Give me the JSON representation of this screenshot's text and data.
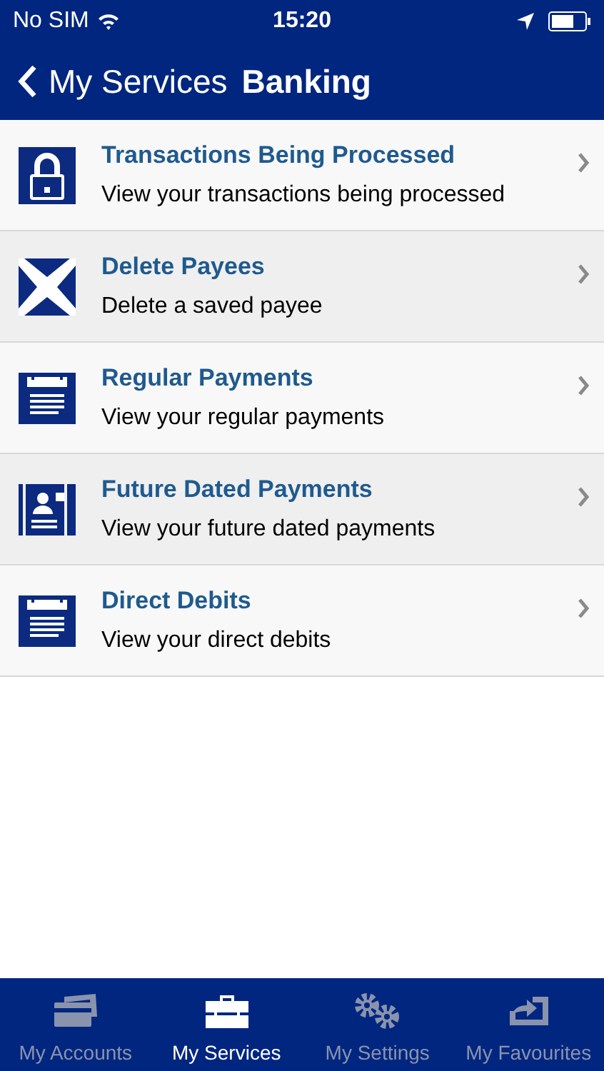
{
  "status_bar": {
    "carrier": "No SIM",
    "time": "15:20"
  },
  "nav_bar": {
    "back_label": "My Services",
    "title": "Banking"
  },
  "items": [
    {
      "kind": "lock",
      "title": "Transactions Being Processed",
      "subtitle": "View your transactions being processed"
    },
    {
      "kind": "cross",
      "title": "Delete Payees",
      "subtitle": "Delete a saved payee"
    },
    {
      "kind": "calendar",
      "title": "Regular Payments",
      "subtitle": "View your regular payments"
    },
    {
      "kind": "person",
      "title": "Future Dated Payments",
      "subtitle": "View your future dated payments"
    },
    {
      "kind": "calendar",
      "title": "Direct Debits",
      "subtitle": "View your direct debits"
    }
  ],
  "tab_bar": [
    {
      "kind": "cards",
      "label": "My Accounts",
      "selected": false
    },
    {
      "kind": "briefcase",
      "label": "My Services",
      "selected": true
    },
    {
      "kind": "gears",
      "label": "My Settings",
      "selected": false
    },
    {
      "kind": "arrow",
      "label": "My Favourites",
      "selected": false
    }
  ]
}
